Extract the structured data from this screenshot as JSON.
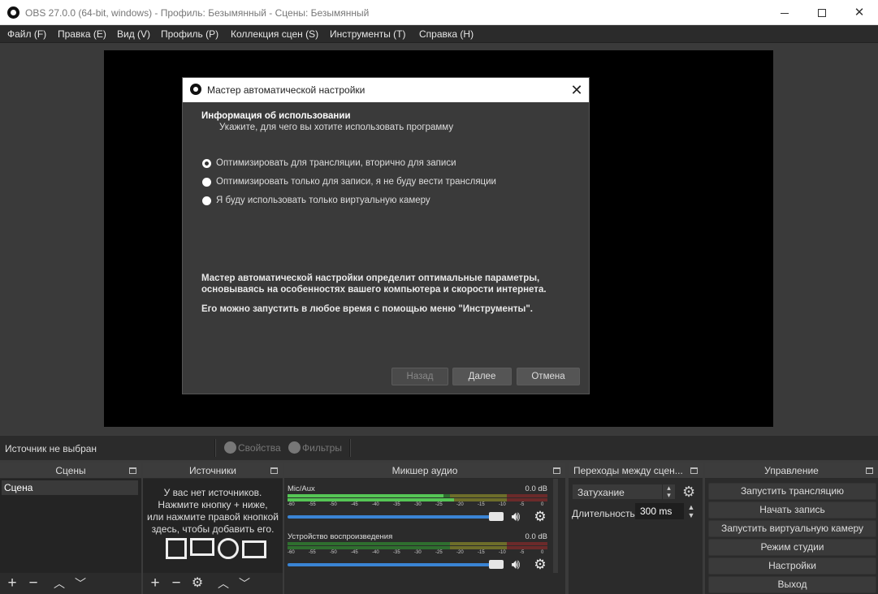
{
  "window": {
    "title": "OBS 27.0.0 (64-bit, windows) - Профиль: Безымянный - Сцены: Безымянный"
  },
  "menu": [
    "Файл (F)",
    "Правка (E)",
    "Вид (V)",
    "Профиль (P)",
    "Коллекция сцен (S)",
    "Инструменты (T)",
    "Справка (H)"
  ],
  "dialog": {
    "title": "Мастер автоматической настройки",
    "heading": "Информация об использовании",
    "subheading": "Укажите, для чего вы хотите использовать программу",
    "options": [
      "Оптимизировать для трансляции, вторично для записи",
      "Оптимизировать только для записи, я не буду вести трансляции",
      "Я буду использовать только виртуальную камеру"
    ],
    "description_line1": "Мастер автоматической настройки определит оптимальные параметры,",
    "description_line2": "основываясь на особенностях вашего компьютера и скорости интернета.",
    "description_line3": "Его можно запустить в любое время с помощью меню \"Инструменты\".",
    "back_label": "Назад",
    "next_label": "Далее",
    "cancel_label": "Отмена"
  },
  "source_bar": {
    "status": "Источник не выбран",
    "properties_label": "Свойства",
    "filters_label": "Фильтры"
  },
  "docks": {
    "scenes": {
      "title": "Сцены",
      "items": [
        "Сцена"
      ]
    },
    "sources": {
      "title": "Источники",
      "empty_line1": "У вас нет источников.",
      "empty_line2": "Нажмите кнопку + ниже,",
      "empty_line3": "или нажмите правой кнопкой",
      "empty_line4": "здесь, чтобы добавить его."
    },
    "mixer": {
      "title": "Микшер аудио",
      "channels": [
        {
          "name": "Mic/Aux",
          "db": "0.0 dB"
        },
        {
          "name": "Устройство воспроизведения",
          "db": "0.0 dB"
        }
      ],
      "scale": [
        "-60",
        "-55",
        "-50",
        "-45",
        "-40",
        "-35",
        "-30",
        "-25",
        "-20",
        "-15",
        "-10",
        "-5",
        "0"
      ]
    },
    "transitions": {
      "title": "Переходы между сцен...",
      "selected": "Затухание",
      "duration_label": "Длительность",
      "duration_value": "300 ms"
    },
    "controls": {
      "title": "Управление",
      "buttons": [
        "Запустить трансляцию",
        "Начать запись",
        "Запустить виртуальную камеру",
        "Режим студии",
        "Настройки",
        "Выход"
      ]
    }
  }
}
